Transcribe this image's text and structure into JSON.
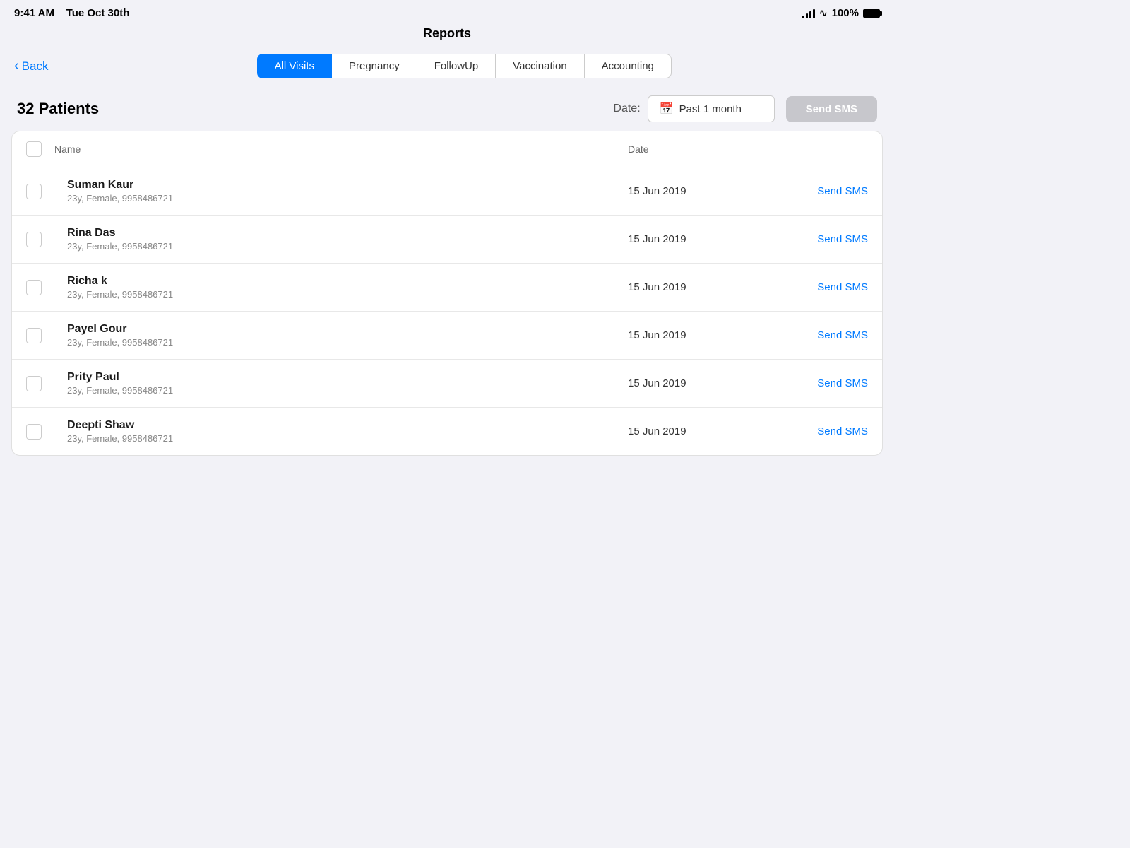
{
  "statusBar": {
    "time": "9:41 AM",
    "date": "Tue Oct 30th",
    "battery": "100%"
  },
  "pageTitle": "Reports",
  "backButton": "Back",
  "tabs": [
    {
      "id": "all-visits",
      "label": "All Visits",
      "active": true
    },
    {
      "id": "pregnancy",
      "label": "Pregnancy",
      "active": false
    },
    {
      "id": "followup",
      "label": "FollowUp",
      "active": false
    },
    {
      "id": "vaccination",
      "label": "Vaccination",
      "active": false
    },
    {
      "id": "accounting",
      "label": "Accounting",
      "active": false
    }
  ],
  "subheader": {
    "patientCount": "32 Patients",
    "dateLabel": "Date:",
    "dateFilter": "Past 1 month",
    "sendSmsButton": "Send SMS"
  },
  "table": {
    "columns": {
      "name": "Name",
      "date": "Date"
    },
    "rows": [
      {
        "id": 1,
        "name": "Suman Kaur",
        "info": "23y, Female, 9958486721",
        "date": "15 Jun 2019",
        "action": "Send SMS"
      },
      {
        "id": 2,
        "name": "Rina Das",
        "info": "23y, Female, 9958486721",
        "date": "15 Jun 2019",
        "action": "Send SMS"
      },
      {
        "id": 3,
        "name": "Richa k",
        "info": "23y, Female, 9958486721",
        "date": "15 Jun 2019",
        "action": "Send SMS"
      },
      {
        "id": 4,
        "name": "Payel Gour",
        "info": "23y, Female, 9958486721",
        "date": "15 Jun  2019",
        "action": "Send SMS"
      },
      {
        "id": 5,
        "name": "Prity Paul",
        "info": "23y, Female, 9958486721",
        "date": "15 Jun  2019",
        "action": "Send SMS"
      },
      {
        "id": 6,
        "name": "Deepti Shaw",
        "info": "23y, Female, 9958486721",
        "date": "15 Jun 2019",
        "action": "Send SMS"
      }
    ]
  }
}
